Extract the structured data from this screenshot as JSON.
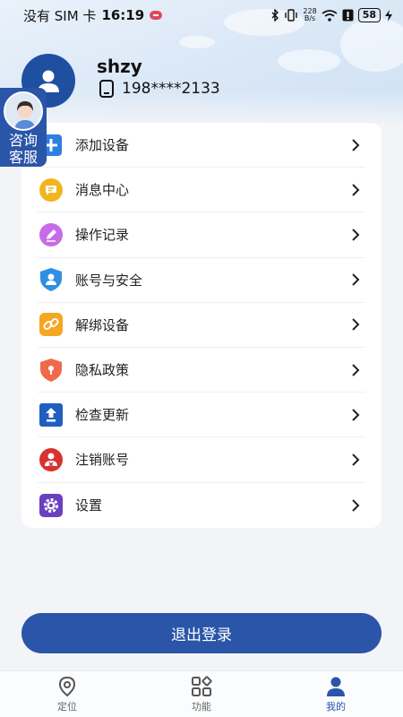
{
  "status_bar": {
    "carrier": "没有 SIM 卡",
    "time": "16:19",
    "net_speed_top": "228",
    "net_speed_bottom": "B/s",
    "battery": "58"
  },
  "profile": {
    "username": "shzy",
    "phone": "198****2133"
  },
  "service_float": {
    "label_line1": "咨询",
    "label_line2": "客服"
  },
  "menu": {
    "items": [
      {
        "label": "添加设备",
        "icon": "add-device-icon",
        "color": "#2f7fe0"
      },
      {
        "label": "消息中心",
        "icon": "message-icon",
        "color": "#f2b51c"
      },
      {
        "label": "操作记录",
        "icon": "edit-record-icon",
        "color": "#c86be8"
      },
      {
        "label": "账号与安全",
        "icon": "shield-user-icon",
        "color": "#2f8fe0"
      },
      {
        "label": "解绑设备",
        "icon": "unlink-icon",
        "color": "#f5a623"
      },
      {
        "label": "隐私政策",
        "icon": "privacy-shield-icon",
        "color": "#f06a4a"
      },
      {
        "label": "检查更新",
        "icon": "update-icon",
        "color": "#1f5fc0"
      },
      {
        "label": "注销账号",
        "icon": "delete-account-icon",
        "color": "#d8322e"
      },
      {
        "label": "设置",
        "icon": "gear-icon",
        "color": "#6a3fc0"
      }
    ]
  },
  "logout": {
    "label": "退出登录"
  },
  "bottom_nav": {
    "tabs": [
      {
        "label": "定位",
        "icon": "location-pin-icon"
      },
      {
        "label": "功能",
        "icon": "grid-apps-icon"
      },
      {
        "label": "我的",
        "icon": "user-icon"
      }
    ]
  },
  "colors": {
    "primary": "#2a55a8",
    "background": "#f2f4f8"
  }
}
